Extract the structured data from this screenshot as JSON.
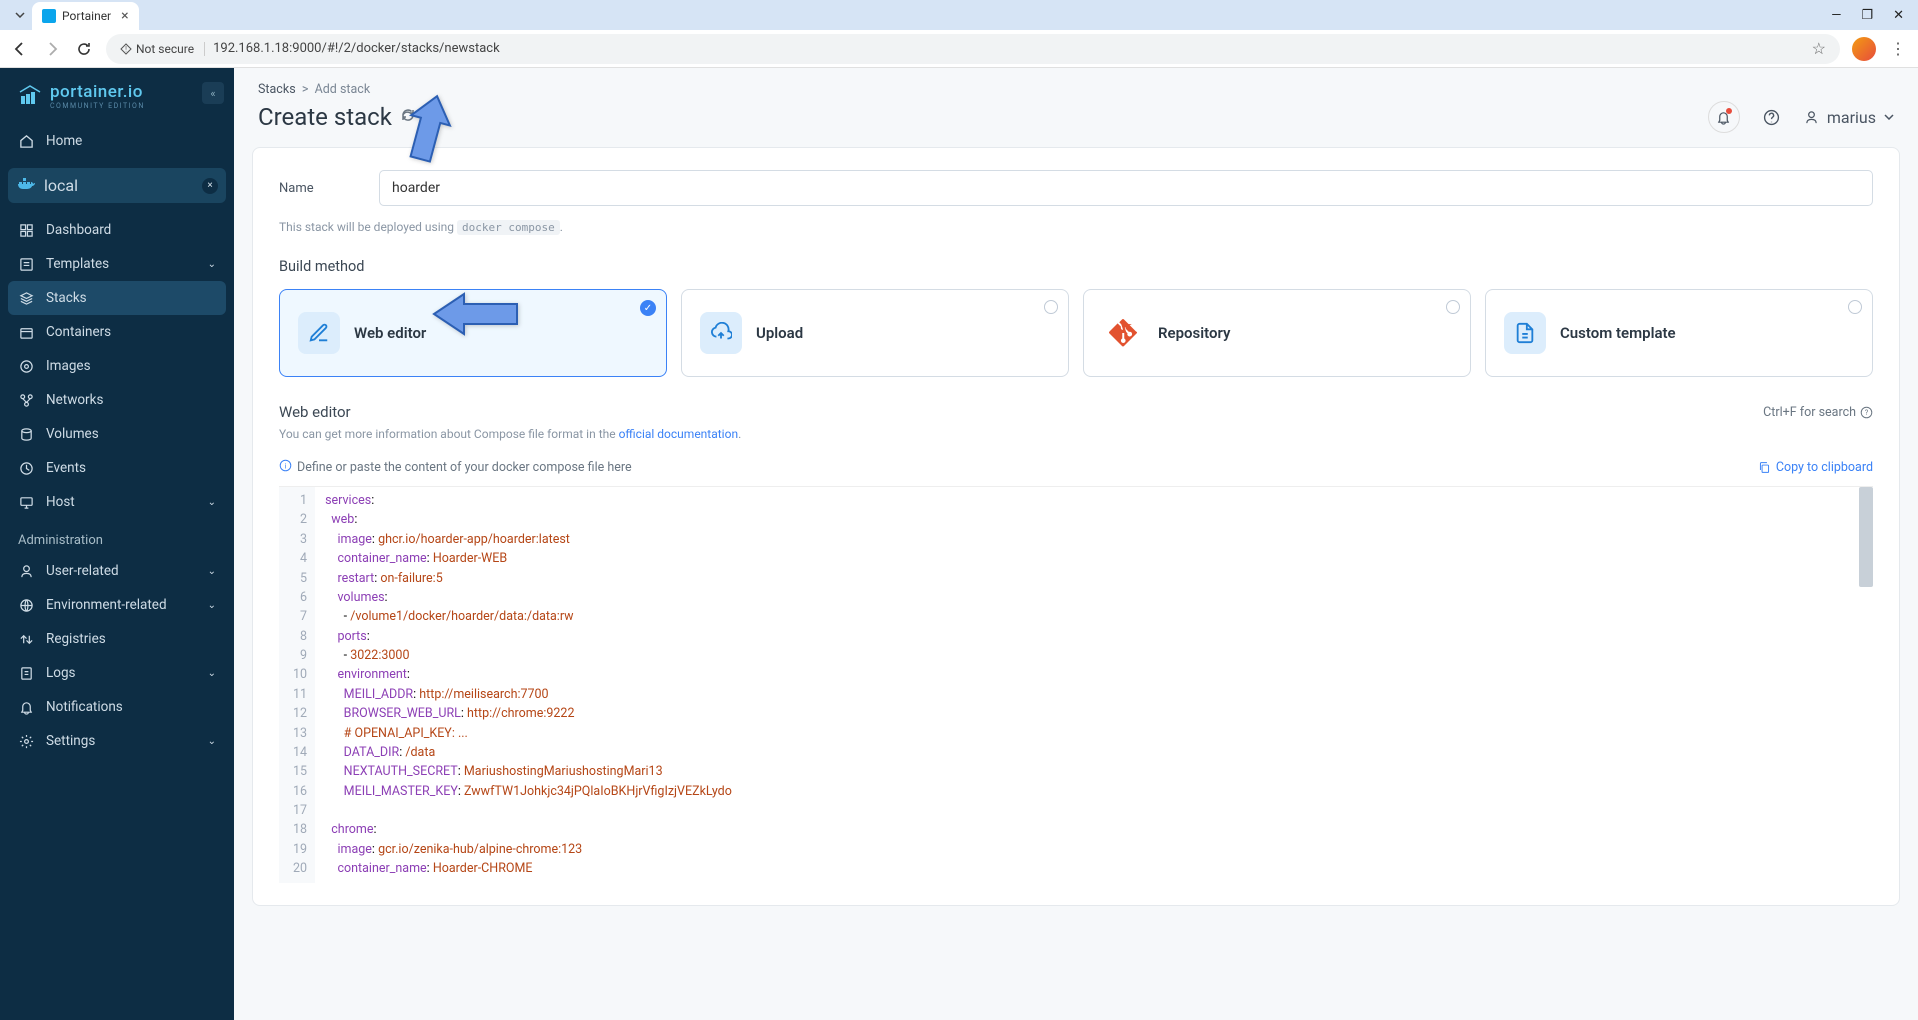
{
  "browser": {
    "tab_title": "Portainer",
    "security_label": "Not secure",
    "url": "192.168.1.18:9000/#!/2/docker/stacks/newstack"
  },
  "sidebar": {
    "logo_name": "portainer.io",
    "logo_sub": "COMMUNITY EDITION",
    "home": "Home",
    "env_name": "local",
    "items": [
      {
        "icon": "dashboard",
        "label": "Dashboard"
      },
      {
        "icon": "templates",
        "label": "Templates",
        "chevron": true
      },
      {
        "icon": "stacks",
        "label": "Stacks",
        "active": true
      },
      {
        "icon": "containers",
        "label": "Containers"
      },
      {
        "icon": "images",
        "label": "Images"
      },
      {
        "icon": "networks",
        "label": "Networks"
      },
      {
        "icon": "volumes",
        "label": "Volumes"
      },
      {
        "icon": "events",
        "label": "Events"
      },
      {
        "icon": "host",
        "label": "Host",
        "chevron": true
      }
    ],
    "admin_label": "Administration",
    "admin_items": [
      {
        "icon": "user",
        "label": "User-related",
        "chevron": true
      },
      {
        "icon": "env",
        "label": "Environment-related",
        "chevron": true
      },
      {
        "icon": "registry",
        "label": "Registries"
      },
      {
        "icon": "logs",
        "label": "Logs",
        "chevron": true
      },
      {
        "icon": "bell",
        "label": "Notifications"
      },
      {
        "icon": "gear",
        "label": "Settings",
        "chevron": true
      }
    ]
  },
  "breadcrumb": {
    "parent": "Stacks",
    "current": "Add stack"
  },
  "page": {
    "title": "Create stack",
    "username": "marius"
  },
  "form": {
    "name_label": "Name",
    "name_value": "hoarder",
    "deploy_hint_pre": "This stack will be deployed using ",
    "deploy_hint_code": "docker compose",
    "deploy_hint_post": ".",
    "build_label": "Build method"
  },
  "build_methods": [
    {
      "id": "web-editor",
      "label": "Web editor",
      "selected": true
    },
    {
      "id": "upload",
      "label": "Upload"
    },
    {
      "id": "repository",
      "label": "Repository"
    },
    {
      "id": "custom-template",
      "label": "Custom template"
    }
  ],
  "editor": {
    "title": "Web editor",
    "shortcut": "Ctrl+F for search",
    "desc_pre": "You can get more information about Compose file format in the ",
    "desc_link": "official documentation",
    "desc_post": ".",
    "placeholder_hint": "Define or paste the content of your docker compose file here",
    "copy_label": "Copy to clipboard",
    "code_lines": [
      {
        "n": 1,
        "tokens": [
          {
            "t": "services",
            "c": "key"
          },
          {
            "t": ":",
            "c": ""
          }
        ]
      },
      {
        "n": 2,
        "tokens": [
          {
            "t": "  ",
            "c": ""
          },
          {
            "t": "web",
            "c": "key"
          },
          {
            "t": ":",
            "c": ""
          }
        ]
      },
      {
        "n": 3,
        "tokens": [
          {
            "t": "    ",
            "c": ""
          },
          {
            "t": "image",
            "c": "key"
          },
          {
            "t": ": ",
            "c": ""
          },
          {
            "t": "ghcr.io/hoarder-app/hoarder:latest",
            "c": "str"
          }
        ]
      },
      {
        "n": 4,
        "tokens": [
          {
            "t": "    ",
            "c": ""
          },
          {
            "t": "container_name",
            "c": "key"
          },
          {
            "t": ": ",
            "c": ""
          },
          {
            "t": "Hoarder-WEB",
            "c": "str"
          }
        ]
      },
      {
        "n": 5,
        "tokens": [
          {
            "t": "    ",
            "c": ""
          },
          {
            "t": "restart",
            "c": "key"
          },
          {
            "t": ": ",
            "c": ""
          },
          {
            "t": "on-failure:5",
            "c": "str"
          }
        ]
      },
      {
        "n": 6,
        "tokens": [
          {
            "t": "    ",
            "c": ""
          },
          {
            "t": "volumes",
            "c": "key"
          },
          {
            "t": ":",
            "c": ""
          }
        ]
      },
      {
        "n": 7,
        "tokens": [
          {
            "t": "      ",
            "c": ""
          },
          {
            "t": "- ",
            "c": ""
          },
          {
            "t": "/volume1/docker/hoarder/data:/data:rw",
            "c": "str"
          }
        ]
      },
      {
        "n": 8,
        "tokens": [
          {
            "t": "    ",
            "c": ""
          },
          {
            "t": "ports",
            "c": "key"
          },
          {
            "t": ":",
            "c": ""
          }
        ]
      },
      {
        "n": 9,
        "tokens": [
          {
            "t": "      ",
            "c": ""
          },
          {
            "t": "- ",
            "c": ""
          },
          {
            "t": "3022:3000",
            "c": "str"
          }
        ]
      },
      {
        "n": 10,
        "tokens": [
          {
            "t": "    ",
            "c": ""
          },
          {
            "t": "environment",
            "c": "key"
          },
          {
            "t": ":",
            "c": ""
          }
        ]
      },
      {
        "n": 11,
        "tokens": [
          {
            "t": "      ",
            "c": ""
          },
          {
            "t": "MEILI_ADDR",
            "c": "key"
          },
          {
            "t": ": ",
            "c": ""
          },
          {
            "t": "http://meilisearch:7700",
            "c": "str"
          }
        ]
      },
      {
        "n": 12,
        "tokens": [
          {
            "t": "      ",
            "c": ""
          },
          {
            "t": "BROWSER_WEB_URL",
            "c": "key"
          },
          {
            "t": ": ",
            "c": ""
          },
          {
            "t": "http://chrome:9222",
            "c": "str"
          }
        ]
      },
      {
        "n": 13,
        "tokens": [
          {
            "t": "      ",
            "c": ""
          },
          {
            "t": "# OPENAI_API_KEY: ...",
            "c": "cmt"
          }
        ]
      },
      {
        "n": 14,
        "tokens": [
          {
            "t": "      ",
            "c": ""
          },
          {
            "t": "DATA_DIR",
            "c": "key"
          },
          {
            "t": ": ",
            "c": ""
          },
          {
            "t": "/data",
            "c": "str"
          }
        ]
      },
      {
        "n": 15,
        "tokens": [
          {
            "t": "      ",
            "c": ""
          },
          {
            "t": "NEXTAUTH_SECRET",
            "c": "key"
          },
          {
            "t": ": ",
            "c": ""
          },
          {
            "t": "MariushostingMariushostingMari13",
            "c": "str"
          }
        ]
      },
      {
        "n": 16,
        "tokens": [
          {
            "t": "      ",
            "c": ""
          },
          {
            "t": "MEILI_MASTER_KEY",
            "c": "key"
          },
          {
            "t": ": ",
            "c": ""
          },
          {
            "t": "ZwwfTW1Johkjc34jPQlaIoBKHjrVfigIzjVEZkLydo",
            "c": "str"
          }
        ]
      },
      {
        "n": 17,
        "tokens": []
      },
      {
        "n": 18,
        "tokens": [
          {
            "t": "  ",
            "c": ""
          },
          {
            "t": "chrome",
            "c": "key"
          },
          {
            "t": ":",
            "c": ""
          }
        ]
      },
      {
        "n": 19,
        "tokens": [
          {
            "t": "    ",
            "c": ""
          },
          {
            "t": "image",
            "c": "key"
          },
          {
            "t": ": ",
            "c": ""
          },
          {
            "t": "gcr.io/zenika-hub/alpine-chrome:123",
            "c": "str"
          }
        ]
      },
      {
        "n": 20,
        "tokens": [
          {
            "t": "    ",
            "c": ""
          },
          {
            "t": "container_name",
            "c": "key"
          },
          {
            "t": ": ",
            "c": ""
          },
          {
            "t": "Hoarder-CHROME",
            "c": "str"
          }
        ]
      }
    ]
  }
}
